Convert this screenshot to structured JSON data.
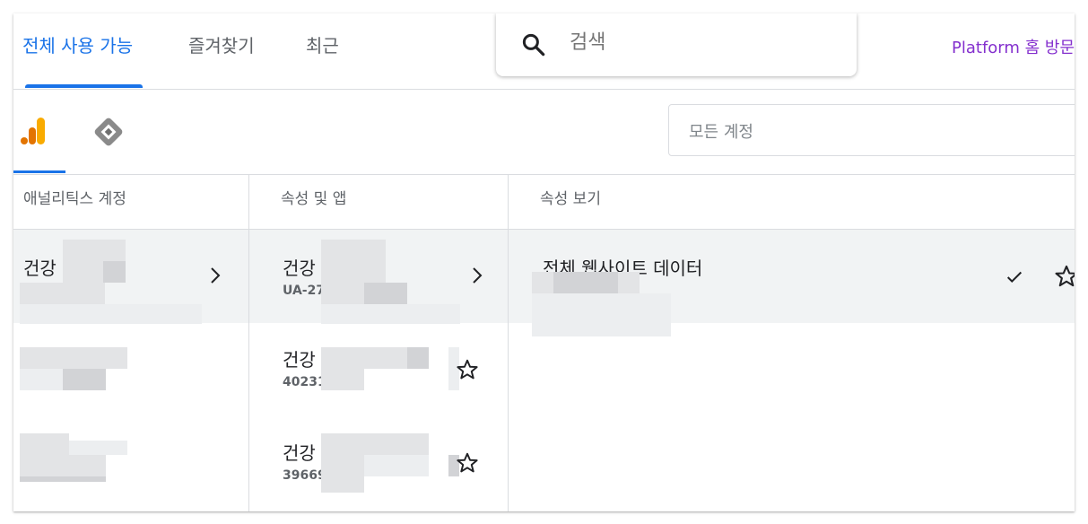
{
  "tabs": [
    {
      "label": "전체 사용 가능",
      "active": true
    },
    {
      "label": "즐겨찾기",
      "active": false
    },
    {
      "label": "최근",
      "active": false
    }
  ],
  "search": {
    "placeholder": "검색"
  },
  "platform_link": "Platform 홈 방문",
  "products": [
    {
      "icon": "analytics-icon",
      "active": true
    },
    {
      "icon": "tag-manager-icon",
      "active": false
    }
  ],
  "account_select": {
    "placeholder": "모든 계정"
  },
  "columns": {
    "accounts": "애널리틱스 계정",
    "properties": "속성 및 앱",
    "views": "속성 보기"
  },
  "accounts": [
    {
      "name": "건강",
      "selected": true
    }
  ],
  "properties": [
    {
      "name": "건강",
      "id": "UA-27",
      "selected": true
    },
    {
      "name": "건강",
      "id": "40231",
      "selected": false
    },
    {
      "name": "건강",
      "id": "39669",
      "selected": false
    }
  ],
  "views": [
    {
      "name": "전체 웹사이트 데이터",
      "selected": true
    }
  ],
  "colors": {
    "accent": "#1a73e8",
    "link": "#8430ce",
    "selected_bg": "#f1f3f4"
  }
}
